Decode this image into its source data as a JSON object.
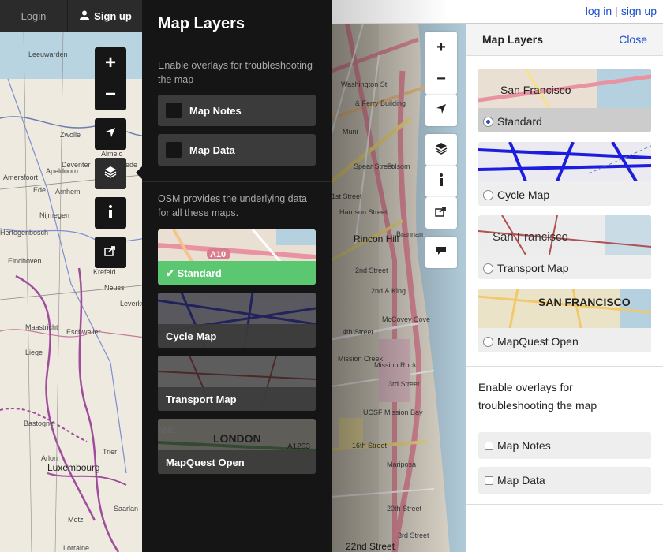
{
  "left": {
    "topbar": {
      "login": "Login",
      "signup": "Sign up"
    },
    "controls": {
      "zoom_in": "+",
      "zoom_out": "−"
    },
    "map_labels": [
      "Leeuwarden",
      "Zwolle",
      "Almelo",
      "Deventer",
      "Enschede",
      "Apeldoorn",
      "Amersfoort",
      "Ede",
      "Arnhem",
      "Nijmegen",
      "Hertogenbosch",
      "Eindhoven",
      "Krefeld",
      "Neuss",
      "Leverku",
      "Maastricht",
      "Eschweiler",
      "Liege",
      "Bastogne",
      "Arlon",
      "Luxembourg",
      "Trier",
      "Saarlan",
      "Metz",
      "Lorraine"
    ],
    "panel": {
      "title": "Map Layers",
      "overlays_text": "Enable overlays for troubleshooting the map",
      "overlays": [
        {
          "label": "Map Notes"
        },
        {
          "label": "Map Data"
        }
      ],
      "provider_text": "OSM provides the underlying data for all these maps.",
      "layers": [
        {
          "label": "Standard",
          "selected": true,
          "thumb_text": "A10"
        },
        {
          "label": "Cycle Map",
          "selected": false
        },
        {
          "label": "Transport Map",
          "selected": false
        },
        {
          "label": "MapQuest Open",
          "selected": false,
          "thumb_text": "LONDON",
          "thumb_text2": "A591",
          "thumb_text3": "A1203"
        }
      ]
    }
  },
  "mid": {
    "map_labels": [
      "Washington St",
      "& Ferry Building",
      "Muni",
      "Spear Street",
      "Folsom",
      "Harrison Street",
      "1st Street",
      "Brannan",
      "Rincon Hill",
      "2nd Street",
      "2nd & King",
      "McCovey Cove",
      "4th Street",
      "Mission Creek",
      "Mission Rock",
      "3rd Street",
      "UCSF Mission Bay",
      "16th Street",
      "Mariposa",
      "20th Street",
      "22nd Street",
      "3rd Street"
    ]
  },
  "top": {
    "login": "log in",
    "separator": "|",
    "signup": "sign up"
  },
  "right": {
    "panel_title": "Map Layers",
    "close": "Close",
    "layers": [
      {
        "label": "Standard",
        "selected": true,
        "thumb_text": "San Francisco"
      },
      {
        "label": "Cycle Map",
        "selected": false
      },
      {
        "label": "Transport Map",
        "selected": false,
        "thumb_text": "San Francisco"
      },
      {
        "label": "MapQuest Open",
        "selected": false,
        "thumb_text": "SAN FRANCISCO"
      }
    ],
    "overlays_text_line1": "Enable overlays for",
    "overlays_text_line2": "troubleshooting the map",
    "overlays": [
      {
        "label": "Map Notes"
      },
      {
        "label": "Map Data"
      }
    ]
  },
  "colors": {
    "selected_green": "#5bc771",
    "dark_panel": "#151515",
    "link_blue": "#1a4ed1"
  }
}
